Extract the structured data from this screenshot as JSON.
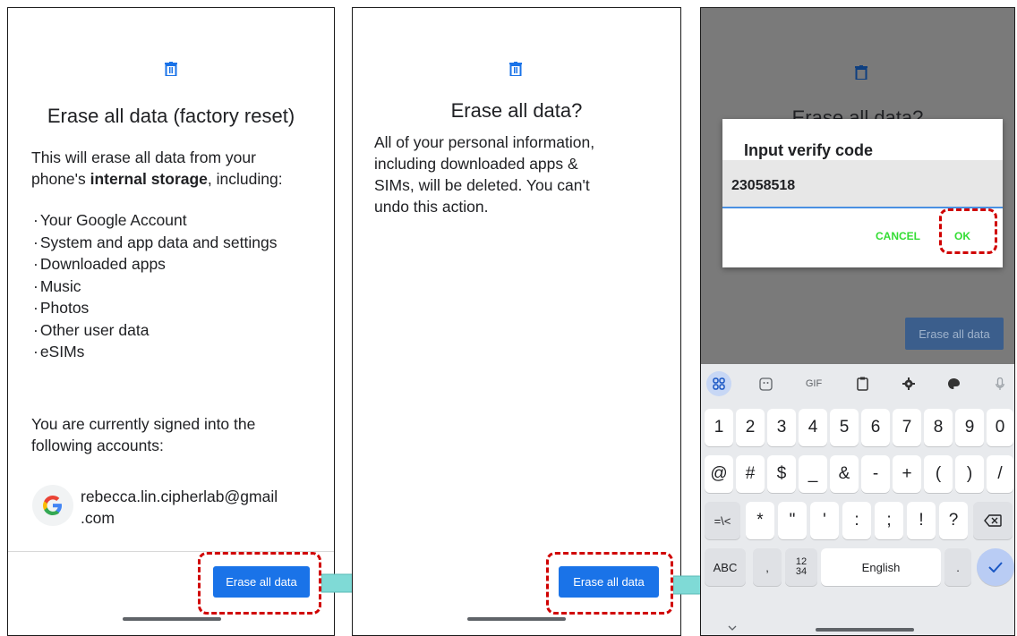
{
  "panel1": {
    "title": "Erase all data (factory reset)",
    "intro_line1": "This will erase all data from your",
    "intro_line2_prefix": "phone's ",
    "intro_line2_bold": "internal storage",
    "intro_line2_suffix": ", including:",
    "items": [
      "Your Google Account",
      "System and app data and settings",
      "Downloaded apps",
      "Music",
      "Photos",
      "Other user data",
      "eSIMs"
    ],
    "signed_in_line1": "You are currently signed into the",
    "signed_in_line2": "following accounts:",
    "account_line1": "rebecca.lin.cipherlab@gmail",
    "account_line2": ".com",
    "button_label": "Erase all data"
  },
  "panel2": {
    "title": "Erase all data?",
    "body_lines": [
      "All of your personal information,",
      "including downloaded apps &",
      "SIMs, will be deleted. You can't",
      "undo this action."
    ],
    "button_label": "Erase all data"
  },
  "panel3": {
    "background_title": "Erase all data?",
    "dialog_title": "Input verify code",
    "code_value": "23058518",
    "cancel_label": "CANCEL",
    "ok_label": "OK",
    "button_label": "Erase all data",
    "keyboard": {
      "tool_gif": "GIF",
      "row1": [
        "1",
        "2",
        "3",
        "4",
        "5",
        "6",
        "7",
        "8",
        "9",
        "0"
      ],
      "row2": [
        "@",
        "#",
        "$",
        "_",
        "&",
        "-",
        "+",
        "(",
        ")",
        "/"
      ],
      "row3_left": "=\\<",
      "row3": [
        "*",
        "\"",
        "'",
        ":",
        ";",
        "!",
        "?"
      ],
      "abc": "ABC",
      "comma": ",",
      "numpad": "12\n34",
      "space": "English",
      "period": "."
    }
  },
  "colors": {
    "accent_blue": "#1a73e8",
    "highlight_red": "#d00000",
    "arrow_teal": "#7fdad6",
    "ok_green": "#33dd33"
  },
  "icons": [
    "trash-icon",
    "google-logo-icon",
    "arrow-right-icon",
    "check-icon",
    "backspace-icon",
    "settings-icon",
    "palette-icon",
    "mic-icon",
    "clipboard-icon",
    "sticker-icon",
    "apps-grid-icon",
    "chevron-down-icon"
  ]
}
